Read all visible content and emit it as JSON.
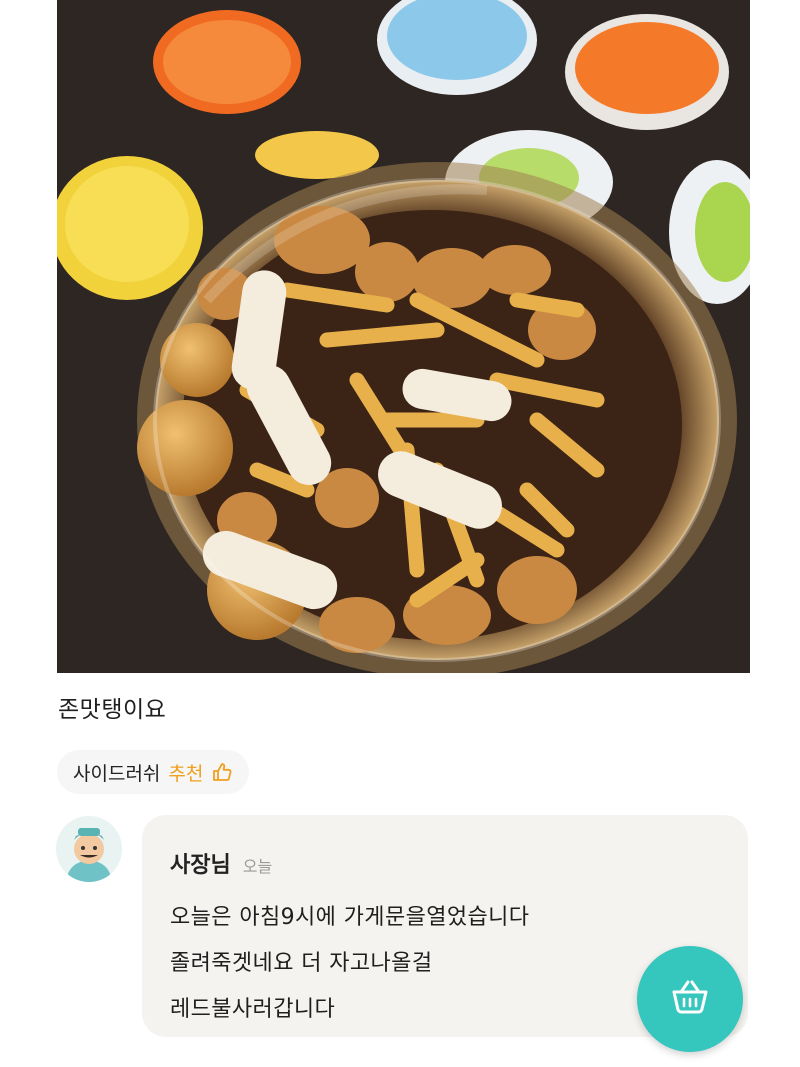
{
  "review": {
    "text": "존맛탱이요",
    "photo_icon": "food-photo"
  },
  "menu_chip": {
    "name": "사이드러쉬",
    "recommend_label": "추천",
    "icon": "thumbs-up-icon",
    "accent_color": "#f0a01e"
  },
  "owner_reply": {
    "author": "사장님",
    "time": "오늘",
    "lines": [
      "오늘은 아침9시에 가게문을열었습니다",
      "졸려죽겟네요 더 자고나올걸",
      "레드불사러갑니다"
    ],
    "card_color": "#f4f3ef"
  },
  "cart_button": {
    "icon": "shopping-basket-icon",
    "color": "#35c6be"
  }
}
